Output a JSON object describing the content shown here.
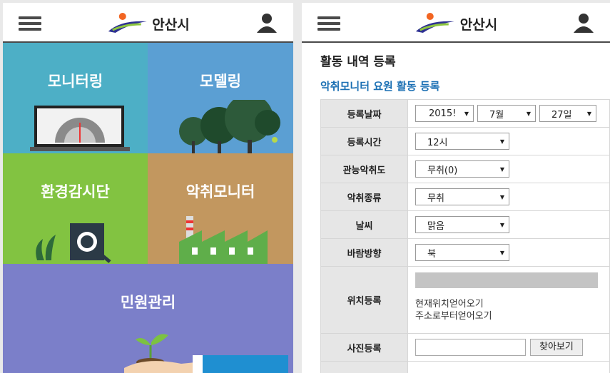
{
  "app": {
    "logo_text": "안산시"
  },
  "left": {
    "tiles": [
      {
        "label": "모니터링",
        "color": "#4dafc6"
      },
      {
        "label": "모델링",
        "color": "#5b9fd3"
      },
      {
        "label": "환경감시단",
        "color": "#82c341"
      },
      {
        "label": "악취모니터",
        "color": "#c2975f"
      },
      {
        "label": "민원관리",
        "color": "#7b7fc9"
      }
    ]
  },
  "right": {
    "page_title": "활동 내역 등록",
    "section_title": "악취모니터 요원 활동 등록",
    "form": {
      "date": {
        "label": "등록날짜",
        "year": "2015!",
        "month": "7월",
        "day": "27일"
      },
      "time": {
        "label": "등록시간",
        "value": "12시"
      },
      "intensity": {
        "label": "관능악취도",
        "value": "무취(0)"
      },
      "odor_type": {
        "label": "악취종류",
        "value": "무취"
      },
      "weather": {
        "label": "날씨",
        "value": "맑음"
      },
      "wind": {
        "label": "바람방향",
        "value": "북"
      },
      "location": {
        "label": "위치등록",
        "link_current": "현재위치얻어오기",
        "link_address": "주소로부터얻어오기"
      },
      "photo": {
        "label": "사진등록",
        "browse_label": "찾아보기"
      }
    }
  }
}
